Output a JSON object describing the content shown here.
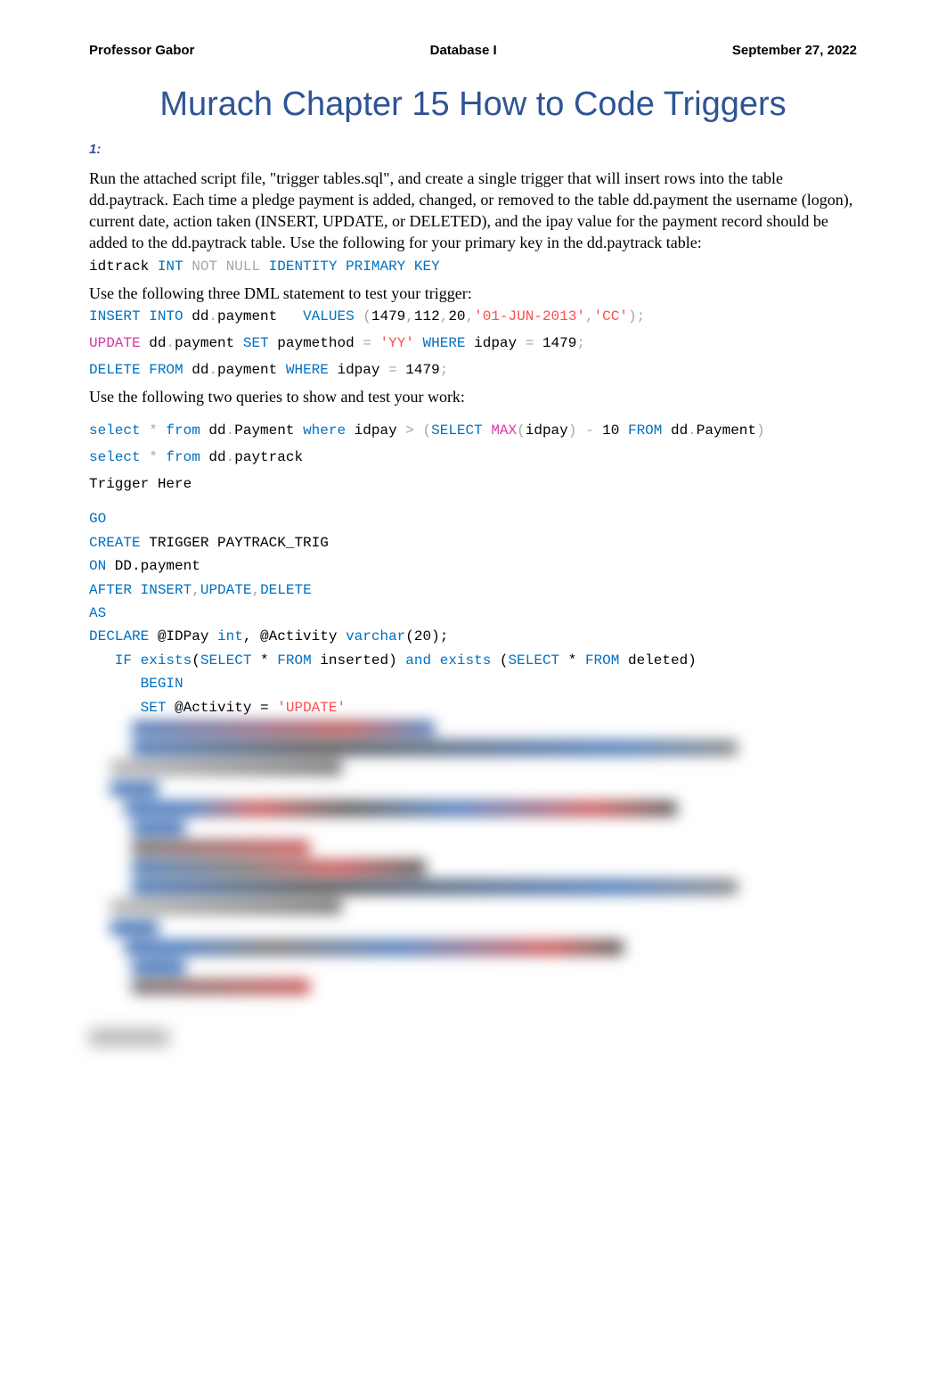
{
  "header": {
    "left": "Professor Gabor",
    "center": "Database I",
    "right": "September 27, 2022"
  },
  "title": "Murach Chapter 15 How to Code Triggers",
  "question_label": "1:",
  "paragraph1": "Run the attached script file, \"trigger tables.sql\", and create a single trigger that will insert rows into the table dd.paytrack. Each time a pledge payment is added, changed, or removed to the table dd.payment the username (logon), current date, action taken (INSERT, UPDATE, or DELETED), and the ipay value for the payment record should be added to the dd.paytrack table. Use the following for your primary key in the dd.paytrack table:",
  "pk_code": {
    "c1": "idtrack ",
    "c2": "INT",
    "c3": " NOT",
    "c4": " NULL",
    "c5": " IDENTITY",
    "c6": " PRIMARY",
    "c7": " KEY"
  },
  "paragraph2": "Use the following three DML statement to test your trigger:",
  "dml": {
    "insert": {
      "a": "INSERT",
      "b": " INTO",
      "c": " dd",
      "dot1": ".",
      "d": "payment   ",
      "e": "VALUES",
      "f": " (",
      "g": "1479",
      "h": ",",
      "i": "112",
      "j": ",",
      "k": "20",
      "l": ",",
      "m": "'01-JUN-2013'",
      "n": ",",
      "o": "'CC'",
      "p": ");"
    },
    "update": {
      "a": "UPDATE",
      "b": " dd",
      "dot1": ".",
      "c": "payment ",
      "d": "SET",
      "e": " paymethod ",
      "eq": "=",
      "f": " 'YY'",
      "g": " WHERE",
      "h": " idpay ",
      "eq2": "=",
      "i": " 1479",
      "j": ";"
    },
    "delete": {
      "a": "DELETE",
      "b": " FROM",
      "c": " dd",
      "dot1": ".",
      "d": "payment ",
      "e": "WHERE",
      "f": " idpay ",
      "eq": "=",
      "g": " 1479",
      "h": ";"
    }
  },
  "paragraph3": "Use the following two queries to show and test your work:",
  "query1": {
    "a": "select",
    "b": " *",
    "c": " from",
    "d": " dd",
    "dot1": ".",
    "e": "Payment ",
    "f": "where",
    "g": " idpay ",
    "gt": ">",
    "h": " (",
    "i": "SELECT",
    "j": " MAX",
    "k": "(",
    "l": "idpay",
    "m": ")",
    "n": " -",
    "o": " 10 ",
    "p": "FROM",
    "q": " dd",
    "dot2": ".",
    "r": "Payment",
    "s": ")"
  },
  "query2": {
    "a": "select",
    "b": " *",
    "c": " from",
    "d": " dd",
    "dot1": ".",
    "e": "paytrack"
  },
  "trigger_here": "Trigger Here",
  "trigger": {
    "l1": "GO",
    "l2a": "CREATE",
    "l2b": " TRIGGER PAYTRACK_TRIG",
    "l3a": "ON",
    "l3b": " DD.payment",
    "l4a": "AFTER",
    "l4b": " INSERT",
    "l4c": ",",
    "l4d": "UPDATE",
    "l4e": ",",
    "l4f": "DELETE",
    "l5": "AS",
    "l6a": "DECLARE",
    "l6b": " @IDPay ",
    "l6c": "int",
    "l6d": ", @Activity ",
    "l6e": "varchar",
    "l6f": "(",
    "l6g": "20",
    "l6h": ");",
    "l7a": "   IF",
    "l7b": " exists",
    "l7c": "(",
    "l7d": "SELECT",
    "l7e": " * ",
    "l7f": "FROM",
    "l7g": " inserted",
    "l7h": ")",
    "l7i": " and",
    "l7j": " exists",
    "l7k": " (",
    "l7l": "SELECT",
    "l7m": " * ",
    "l7n": "FROM",
    "l7o": " deleted",
    "l7p": ")",
    "l8": "      BEGIN",
    "l9a": "      SET",
    "l9b": " @Activity ",
    "l9c": "=",
    "l9d": " 'UPDATE'"
  }
}
